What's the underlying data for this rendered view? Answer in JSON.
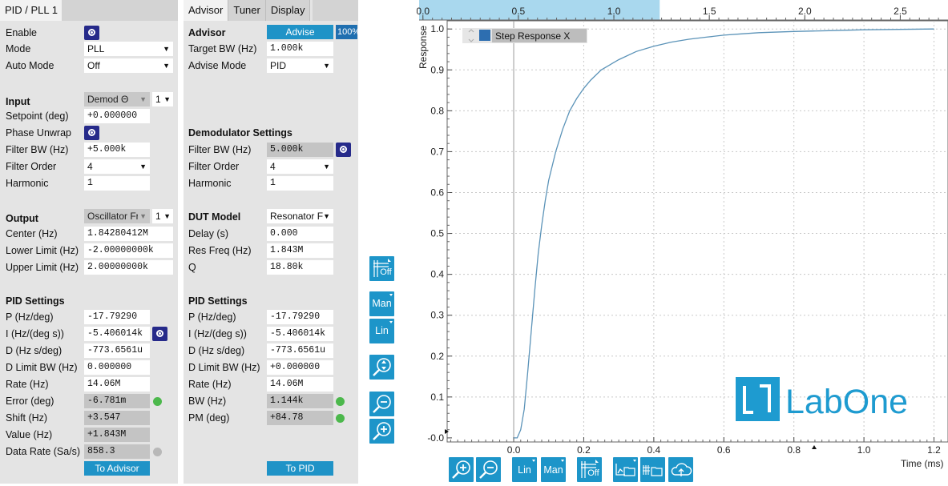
{
  "left_panel": {
    "tab": "PID / PLL 1",
    "enable_label": "Enable",
    "mode_label": "Mode",
    "mode_value": "PLL",
    "auto_mode_label": "Auto Mode",
    "auto_mode_value": "Off",
    "input_header": "Input",
    "input_source": "Demod Θ",
    "input_channel": "1",
    "setpoint_label": "Setpoint (deg)",
    "setpoint_value": "+0.000000",
    "phase_unwrap_label": "Phase Unwrap",
    "filter_bw_label": "Filter BW (Hz)",
    "filter_bw_value": "+5.000k",
    "filter_order_label": "Filter Order",
    "filter_order_value": "4",
    "harmonic_label": "Harmonic",
    "harmonic_value": "1",
    "output_header": "Output",
    "output_target": "Oscillator Fr",
    "output_channel": "1",
    "center_label": "Center (Hz)",
    "center_value": "1.84280412M",
    "lower_limit_label": "Lower Limit (Hz)",
    "lower_limit_value": "-2.00000000k",
    "upper_limit_label": "Upper Limit (Hz)",
    "upper_limit_value": "2.00000000k",
    "pid_header": "PID Settings",
    "p_label": "P (Hz/deg)",
    "p_value": "-17.79290",
    "i_label": "I (Hz/(deg s))",
    "i_value": "-5.406014k",
    "d_label": "D (Hz s/deg)",
    "d_value": "-773.6561u",
    "dlimit_label": "D Limit BW (Hz)",
    "dlimit_value": "0.000000",
    "rate_label": "Rate (Hz)",
    "rate_value": "14.06M",
    "error_label": "Error (deg)",
    "error_value": "-6.781m",
    "shift_label": "Shift (Hz)",
    "shift_value": "+3.547",
    "value_label": "Value (Hz)",
    "value_value": "+1.843M",
    "data_rate_label": "Data Rate (Sa/s)",
    "data_rate_value": "858.3",
    "to_advisor": "To Advisor"
  },
  "mid_panel": {
    "tabs": [
      "Advisor",
      "Tuner",
      "Display"
    ],
    "advisor_header": "Advisor",
    "advise_button": "Advise",
    "progress": "100%",
    "target_bw_label": "Target BW (Hz)",
    "target_bw_value": "1.000k",
    "advise_mode_label": "Advise Mode",
    "advise_mode_value": "PID",
    "demod_header": "Demodulator Settings",
    "filter_bw_label": "Filter BW (Hz)",
    "filter_bw_value": "5.000k",
    "filter_order_label": "Filter Order",
    "filter_order_value": "4",
    "harmonic_label": "Harmonic",
    "harmonic_value": "1",
    "dut_header": "DUT Model",
    "dut_value": "Resonator F",
    "delay_label": "Delay (s)",
    "delay_value": "0.000",
    "res_freq_label": "Res Freq (Hz)",
    "res_freq_value": "1.843M",
    "q_label": "Q",
    "q_value": "18.80k",
    "pid_header": "PID Settings",
    "p_label": "P (Hz/deg)",
    "p_value": "-17.79290",
    "i_label": "I (Hz/(deg s))",
    "i_value": "-5.406014k",
    "d_label": "D (Hz s/deg)",
    "d_value": "-773.6561u",
    "dlimit_label": "D Limit BW (Hz)",
    "dlimit_value": "+0.000000",
    "rate_label": "Rate (Hz)",
    "rate_value": "14.06M",
    "bw_label": "BW (Hz)",
    "bw_value": "1.144k",
    "pm_label": "PM (deg)",
    "pm_value": "+84.78",
    "to_pid": "To PID"
  },
  "toolbar": {
    "off_label": "Off",
    "man_label": "Man",
    "lin_label": "Lin"
  },
  "chart_data": {
    "type": "line",
    "series": [
      {
        "name": "Step Response X",
        "x": [
          0.0,
          0.01,
          0.02,
          0.03,
          0.04,
          0.05,
          0.06,
          0.07,
          0.08,
          0.09,
          0.1,
          0.12,
          0.14,
          0.16,
          0.18,
          0.2,
          0.22,
          0.25,
          0.28,
          0.3,
          0.35,
          0.4,
          0.45,
          0.5,
          0.55,
          0.6,
          0.65,
          0.7,
          0.8,
          0.9,
          1.0,
          1.1,
          1.2
        ],
        "y": [
          0.0,
          0.0,
          0.02,
          0.07,
          0.16,
          0.26,
          0.36,
          0.45,
          0.52,
          0.58,
          0.63,
          0.7,
          0.755,
          0.8,
          0.83,
          0.855,
          0.875,
          0.9,
          0.915,
          0.925,
          0.945,
          0.958,
          0.968,
          0.975,
          0.98,
          0.985,
          0.988,
          0.991,
          0.994,
          0.996,
          0.998,
          0.999,
          1.0
        ]
      }
    ],
    "xlabel": "Time (ms)",
    "ylabel": "Response",
    "xlim": [
      -0.19,
      1.24
    ],
    "ylim": [
      -0.01,
      1.02
    ],
    "x_ticks": [
      "0.0",
      "0.2",
      "0.4",
      "0.6",
      "0.8",
      "1.0",
      "1.2"
    ],
    "y_ticks": [
      "-0.0",
      "0.1",
      "0.2",
      "0.3",
      "0.4",
      "0.5",
      "0.6",
      "0.7",
      "0.8",
      "0.9",
      "1.0"
    ],
    "overview_ticks": [
      "0.0",
      "0.5",
      "1.0",
      "1.5",
      "2.0",
      "2.5"
    ],
    "overview_range": [
      -0.02,
      2.75
    ],
    "overview_selection": [
      -0.02,
      1.24
    ],
    "grid": true,
    "legend": "top-left",
    "line_color": "#5b93b8"
  },
  "logo": {
    "text": "LabOne",
    "color": "#1e9bd0"
  }
}
